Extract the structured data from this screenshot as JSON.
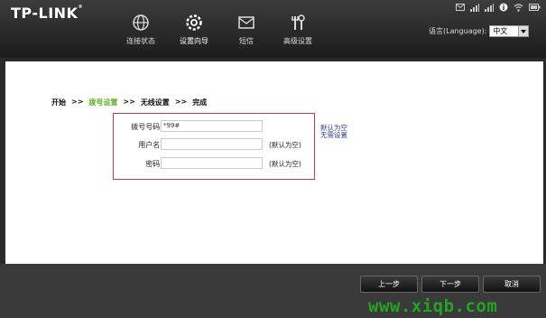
{
  "header": {
    "logo": "TP-LINK",
    "nav": [
      {
        "label": "连接状态",
        "icon": "globe-icon"
      },
      {
        "label": "设置向导",
        "icon": "settings-icon"
      },
      {
        "label": "短信",
        "icon": "envelope-icon"
      },
      {
        "label": "高级设置",
        "icon": "tools-icon"
      }
    ],
    "status_icons": [
      "mail-icon",
      "signal-icon",
      "signal-icon",
      "info-icon",
      "wifi-icon",
      "battery-icon"
    ],
    "language_label": "语言(Language):",
    "language_value": "中文"
  },
  "breadcrumb": {
    "steps": [
      "开始",
      "拨号设置",
      "无线设置",
      "完成"
    ],
    "separator": ">>",
    "current_index": 1
  },
  "form": {
    "rows": [
      {
        "label": "拨号号码:",
        "value": "*99#",
        "note": ""
      },
      {
        "label": "用户名:",
        "value": "",
        "note": "(默认为空)"
      },
      {
        "label": "密码:",
        "value": "",
        "note": "(默认为空)"
      }
    ],
    "side_note": [
      "默认为空",
      "无需设置"
    ]
  },
  "buttons": {
    "prev": "上一步",
    "next": "下一步",
    "cancel": "取消"
  },
  "watermark": "www.xiqb.com",
  "colors": {
    "accent_green": "#5fae1f",
    "form_border": "#b74040",
    "watermark": "#23a323"
  }
}
